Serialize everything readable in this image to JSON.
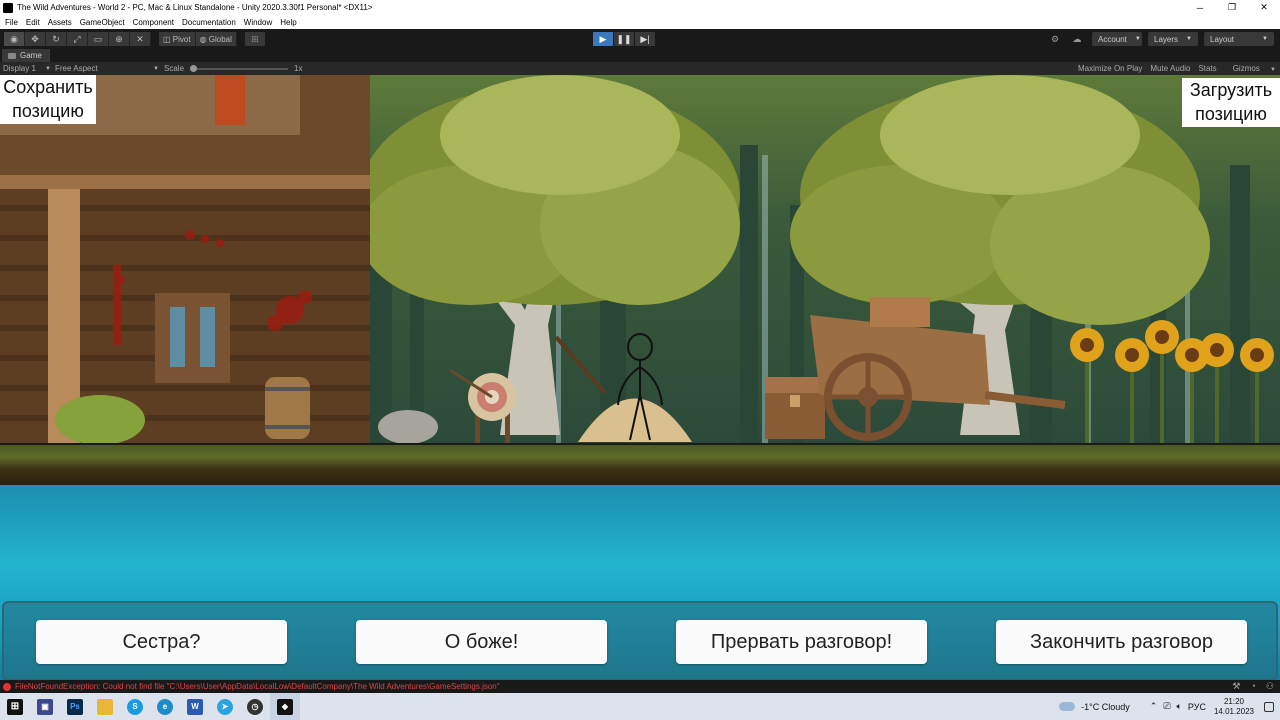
{
  "window": {
    "title": "The Wild Adventures - World 2 - PC, Mac & Linux Standalone - Unity 2020.3.30f1 Personal* <DX11>",
    "controls": [
      "─",
      "❐",
      "✕"
    ]
  },
  "menu": [
    "File",
    "Edit",
    "Assets",
    "GameObject",
    "Component",
    "Documentation",
    "Window",
    "Help"
  ],
  "toolbar": {
    "pivot_label": "Pivot",
    "global_label": "Global",
    "account_label": "Account",
    "layers_label": "Layers",
    "layout_label": "Layout"
  },
  "game_tab": {
    "label": "Game"
  },
  "game_bar": {
    "display": "Display 1",
    "aspect": "Free Aspect",
    "scale_label": "Scale",
    "scale_value": "1x",
    "maximize": "Maximize On Play",
    "mute": "Mute Audio",
    "stats": "Stats",
    "gizmos": "Gizmos"
  },
  "game": {
    "save_button": "Сохранить позицию",
    "load_button": "Загрузить позицию",
    "choices": [
      "Сестра?",
      "О боже!",
      "Прервать разговор!",
      "Закончить разговор"
    ]
  },
  "console": {
    "error": "FileNotFoundException: Could not find file \"C:\\Users\\User\\AppData\\LocalLow\\DefaultCompany\\The Wild Adventures\\GameSettings.json\""
  },
  "taskbar": {
    "weather": "-1°C  Cloudy",
    "lang": "РУС",
    "time": "21:20",
    "date": "14.01.2023"
  },
  "colors": {
    "play_active": "#3a79bb",
    "water": "#22b3cf",
    "error_text": "#dd4444"
  }
}
